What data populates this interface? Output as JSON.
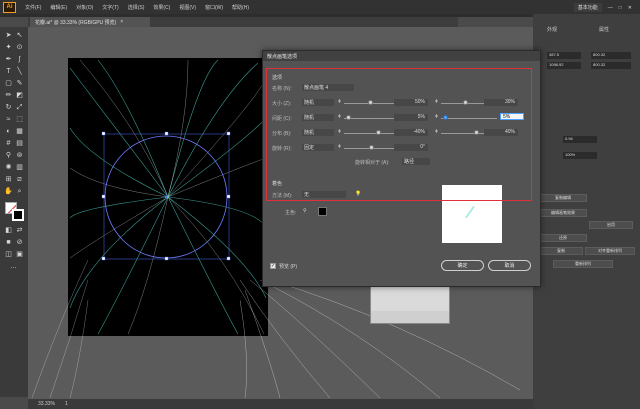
{
  "app": {
    "logo": "Ai"
  },
  "menubar": {
    "items": [
      "文件(F)",
      "编辑(E)",
      "对象(O)",
      "文字(T)",
      "选择(S)",
      "效果(C)",
      "视图(V)",
      "窗口(W)",
      "帮助(H)"
    ],
    "workspace": "基本功能"
  },
  "document": {
    "tab_title": "花瓣.ai* @ 33.33% (RGB/GPU 预览)",
    "tab_close": "×"
  },
  "dialog": {
    "title": "散点画笔选项",
    "section_options": "选项",
    "name_label": "名称 (N):",
    "name_value": "散点画笔 4",
    "rows": [
      {
        "label": "大小 (Z):",
        "mode": "随机",
        "min": "50%",
        "max": "30%"
      },
      {
        "label": "间距 (C):",
        "mode": "随机",
        "min": "5%",
        "max": "5%"
      },
      {
        "label": "分布 (B):",
        "mode": "随机",
        "min": "-40%",
        "max": "40%"
      },
      {
        "label": "旋转 (R):",
        "mode": "固定",
        "min": "0°",
        "max": ""
      }
    ],
    "rotate_relative_label": "旋转相对于 (A):",
    "rotate_relative_value": "路径",
    "section_color": "着色",
    "method_label": "方法 (M):",
    "method_value": "无",
    "key_color_label": "主色:",
    "preview_label": "预览 (P)",
    "ok": "确定",
    "cancel": "取消"
  },
  "right_panel": {
    "tabs": [
      "外观",
      "属性"
    ],
    "fields": [
      "387.5",
      "800.32",
      "1098.92",
      "800.32",
      "0.94",
      "100%"
    ],
    "buttons": [
      "复制编辑",
      "编辑画笔效果",
      "启用",
      "还原",
      "复制",
      "对齐重新排列",
      "重新排列"
    ]
  },
  "status": {
    "zoom": "33.33%",
    "page": "1"
  },
  "colors": {
    "highlight": "#e0313b",
    "accent": "#4da3ff",
    "logo": "#f59a23"
  }
}
